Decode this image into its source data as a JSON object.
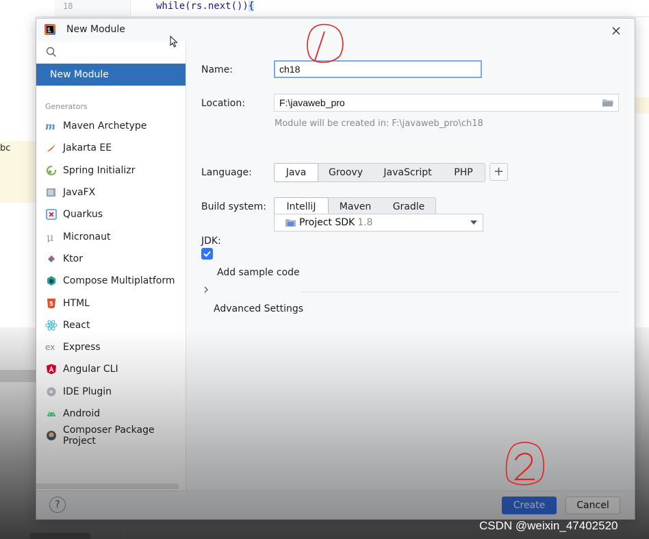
{
  "ide": {
    "line_number": "18",
    "code_line": "while(rs.next())",
    "code_cursor_char": "{",
    "left_fragment": "bc"
  },
  "dialog": {
    "title": "New Module",
    "search_placeholder": "",
    "selected_nav": "New Module",
    "generators_label": "Generators",
    "generators": [
      {
        "label": "Maven Archetype",
        "icon": "maven-icon"
      },
      {
        "label": "Jakarta EE",
        "icon": "jakarta-icon"
      },
      {
        "label": "Spring Initializr",
        "icon": "spring-icon"
      },
      {
        "label": "JavaFX",
        "icon": "javafx-icon"
      },
      {
        "label": "Quarkus",
        "icon": "quarkus-icon"
      },
      {
        "label": "Micronaut",
        "icon": "micronaut-icon"
      },
      {
        "label": "Ktor",
        "icon": "ktor-icon"
      },
      {
        "label": "Compose Multiplatform",
        "icon": "compose-icon"
      },
      {
        "label": "HTML",
        "icon": "html5-icon"
      },
      {
        "label": "React",
        "icon": "react-icon"
      },
      {
        "label": "Express",
        "icon": "express-icon"
      },
      {
        "label": "Angular CLI",
        "icon": "angular-icon"
      },
      {
        "label": "IDE Plugin",
        "icon": "ide-plugin-icon"
      },
      {
        "label": "Android",
        "icon": "android-icon"
      },
      {
        "label": "Composer Package Project",
        "icon": "composer-icon"
      }
    ],
    "form": {
      "name_label": "Name:",
      "name_value": "ch18",
      "location_label": "Location:",
      "location_value": "F:\\javaweb_pro",
      "location_hint": "Module will be created in: F:\\javaweb_pro\\ch18",
      "language_label": "Language:",
      "languages": [
        "Java",
        "Groovy",
        "JavaScript",
        "PHP"
      ],
      "language_selected": "Java",
      "add_language": "+",
      "build_label": "Build system:",
      "build_systems": [
        "IntelliJ",
        "Maven",
        "Gradle"
      ],
      "build_selected": "IntelliJ",
      "jdk_label": "JDK:",
      "jdk_value": "Project SDK",
      "jdk_version": "1.8",
      "sample_code_label": "Add sample code",
      "sample_code_checked": true,
      "advanced_label": "Advanced Settings"
    },
    "footer": {
      "help": "?",
      "create": "Create",
      "cancel": "Cancel"
    }
  },
  "colors": {
    "accent": "#3574f0",
    "selected_nav": "#2f6fba",
    "annotation": "#e0241c"
  },
  "watermark": "CSDN @weixin_47402520"
}
